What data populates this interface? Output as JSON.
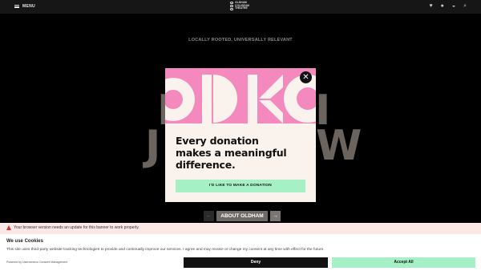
{
  "header": {
    "menu_label": "MENU",
    "logo_text_1": "OLDHAM",
    "logo_text_2": "COLISEUM",
    "logo_text_3": "THEATRE",
    "icons": [
      "heart-icon",
      "user-icon",
      "basket-icon",
      "search-icon"
    ]
  },
  "hero": {
    "tagline": "LOCALLY ROOTED, UNIVERSALLY RELEVANT",
    "about_label": "ABOUT OLDHAM"
  },
  "modal": {
    "title_line1": "Every donation",
    "title_line2": "makes a meaningful",
    "title_line3": "difference.",
    "donate_label": "I'D LIKE TO MAKE A DONATION",
    "close_glyph": "✕",
    "art_colors": {
      "pink": "#f389bd",
      "cream": "#faf2ec"
    }
  },
  "cookie": {
    "warning": "Your browser version needs an update for this banner to work properly.",
    "title": "We use Cookies",
    "description": "This site uses third-party website tracking technologies to provide and continually improve our services. I agree and may revoke or change my consent at any time with effect for the future.",
    "powered": "Powered by Usercentrics Consent Management",
    "deny_label": "Deny",
    "accept_label": "Accept All"
  },
  "colors": {
    "accent_green": "#a6f0c6",
    "pink": "#f389bd",
    "warning_red": "#d63030"
  }
}
